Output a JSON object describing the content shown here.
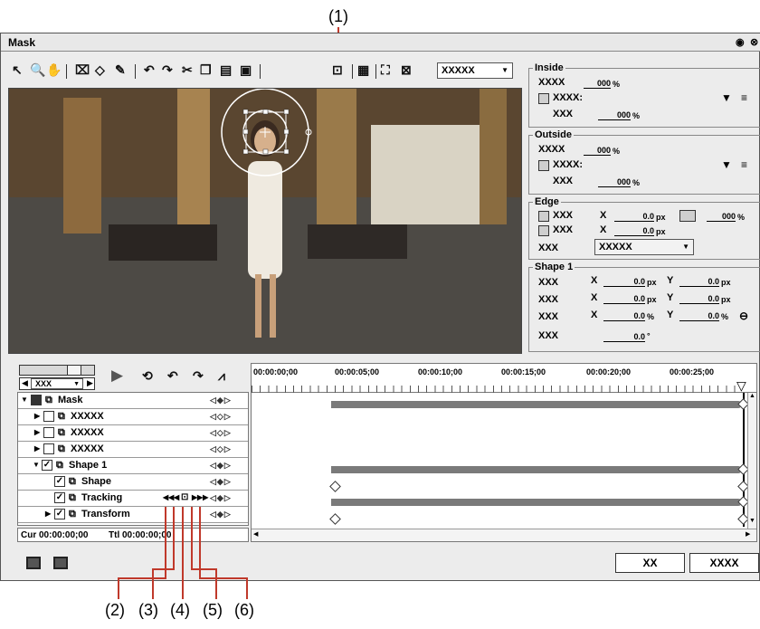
{
  "callouts": [
    "(1)",
    "(2)",
    "(3)",
    "(4)",
    "(5)",
    "(6)"
  ],
  "window": {
    "title": "Mask",
    "title_icons": [
      "settings-circle-icon",
      "close-icon"
    ]
  },
  "toolbar": {
    "icons": [
      "arrow-select-icon",
      "zoom-icon",
      "hand-icon",
      "transform-icon",
      "ellipse-icon",
      "pen-icon",
      "undo-icon",
      "redo-icon",
      "cut-icon",
      "copy-icon",
      "paste-icon",
      "delete-icon",
      "tracking-icon",
      "grid-icon",
      "fit-icon",
      "fullscreen-icon"
    ],
    "dropdown_value": "XXXXX"
  },
  "inside": {
    "header": "Inside",
    "opacity_label": "XXXX",
    "opacity_value": "000",
    "opacity_unit": "%",
    "check_label": "XXXX:",
    "sub_label": "XXX",
    "sub_value": "000",
    "sub_unit": "%"
  },
  "outside": {
    "header": "Outside",
    "opacity_label": "XXXX",
    "opacity_value": "000",
    "opacity_unit": "%",
    "check_label": "XXXX:",
    "sub_label": "XXX",
    "sub_value": "000",
    "sub_unit": "%"
  },
  "edge": {
    "header": "Edge",
    "row1_label": "XXX",
    "row1_x": "X",
    "row1_value": "0.0",
    "row1_unit": "px",
    "row1_pct_value": "000",
    "row1_pct_unit": "%",
    "row2_label": "XXX",
    "row2_x": "X",
    "row2_value": "0.0",
    "row2_unit": "px",
    "row3_label": "XXX",
    "row3_dropdown": "XXXXX"
  },
  "shape1": {
    "header": "Shape 1",
    "rows": [
      {
        "label": "XXX",
        "x": "X",
        "xv": "0.0",
        "xu": "px",
        "y": "Y",
        "yv": "0.0",
        "yu": "px"
      },
      {
        "label": "XXX",
        "x": "X",
        "xv": "0.0",
        "xu": "px",
        "y": "Y",
        "yv": "0.0",
        "yu": "px"
      },
      {
        "label": "XXX",
        "x": "X",
        "xv": "0.0",
        "xu": "%",
        "y": "Y",
        "yv": "0.0",
        "yu": "%"
      }
    ],
    "angle_label": "XXX",
    "angle_value": "0.0",
    "angle_unit": "°"
  },
  "transport": {
    "zoom_value": "XXX"
  },
  "timecodes": [
    "00:00:00;00",
    "00:00:05;00",
    "00:00:10;00",
    "00:00:15;00",
    "00:00:20;00",
    "00:00:25;00"
  ],
  "tracks": [
    {
      "name": "Mask",
      "kf": "◁◆▷"
    },
    {
      "name": "XXXXX",
      "kf": "◁◇▷"
    },
    {
      "name": "XXXXX",
      "kf": "◁◇▷"
    },
    {
      "name": "XXXXX",
      "kf": "◁◇▷"
    },
    {
      "name": "Shape 1",
      "kf": "◁◆▷"
    },
    {
      "name": "Shape",
      "kf": "◁◆▷"
    },
    {
      "name": "Tracking",
      "kf": "◁◆▷"
    },
    {
      "name": "Transform",
      "kf": "◁◆▷"
    }
  ],
  "status": {
    "cur": "Cur 00:00:00;00",
    "ttl": "Ttl 00:00:00;00"
  },
  "buttons": {
    "ok": "XX",
    "cancel": "XXXX"
  }
}
